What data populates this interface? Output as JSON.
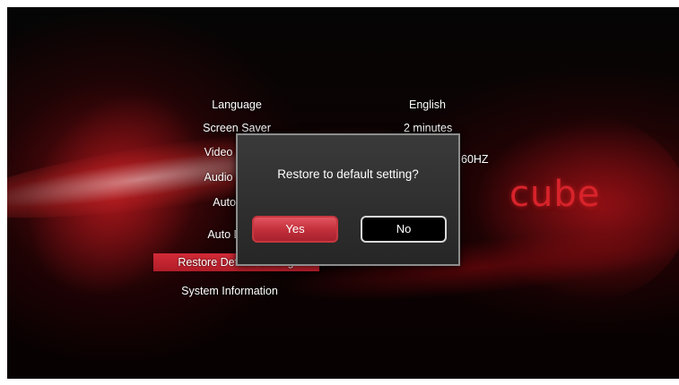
{
  "logo": {
    "text": "cube"
  },
  "settings_menu": {
    "items": [
      {
        "label": "Language",
        "value": "English"
      },
      {
        "label": "Screen Saver",
        "value": "2 minutes"
      },
      {
        "label": "Video Output",
        "value": "60HZ"
      },
      {
        "label": "Audio Output",
        "value": ""
      },
      {
        "label": "Auto Play",
        "value": ""
      },
      {
        "label": "Auto Detect",
        "value": ""
      },
      {
        "label": "Restore Default Setting",
        "value": ""
      },
      {
        "label": "System Information",
        "value": ""
      }
    ],
    "selected_label": "Restore Default Setting"
  },
  "dialog": {
    "message": "Restore to default setting?",
    "yes_label": "Yes",
    "no_label": "No"
  },
  "colors": {
    "accent": "#c8232d",
    "dialog_bg": "#303030",
    "dialog_border": "#8d8d8d"
  }
}
